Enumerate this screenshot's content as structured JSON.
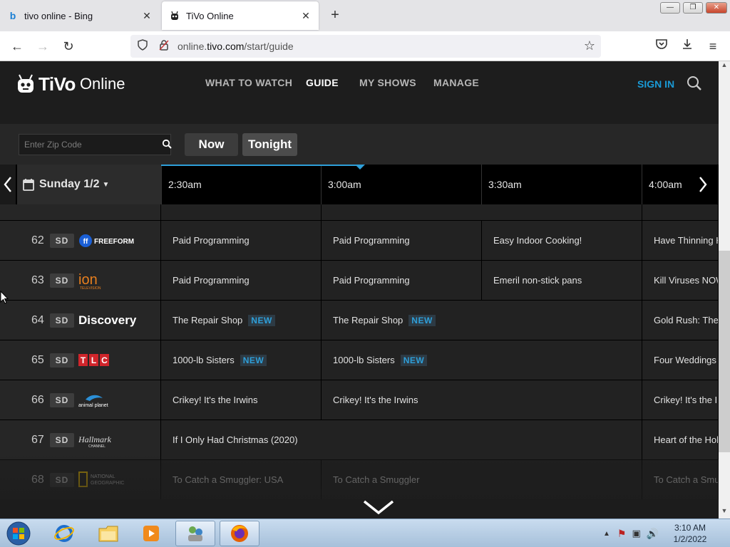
{
  "browser": {
    "tabs": [
      {
        "title": "tivo online - Bing",
        "favicon": "bing-icon",
        "active": false
      },
      {
        "title": "TiVo Online",
        "favicon": "tivo-icon",
        "active": true
      }
    ],
    "url_domain_prefix": "online.",
    "url_domain": "tivo.com",
    "url_path": "/start/guide"
  },
  "site": {
    "brand": "TiVo",
    "brand_suffix": "Online",
    "nav": [
      "WHAT TO WATCH",
      "GUIDE",
      "MY SHOWS",
      "MANAGE"
    ],
    "active_nav": "GUIDE",
    "sign_in": "SIGN IN",
    "accent": "#2e9fd9"
  },
  "controls": {
    "zip_placeholder": "Enter Zip Code",
    "now_label": "Now",
    "tonight_label": "Tonight"
  },
  "guide": {
    "date": "Sunday 1/2",
    "time_slots": [
      "2:30am",
      "3:00am",
      "3:30am",
      "4:00am"
    ],
    "channels": [
      {
        "number": "62",
        "quality": "SD",
        "logo": "freeform-logo",
        "logo_text": "FREEFORM",
        "programs": [
          {
            "title": "Paid Programming",
            "new": false
          },
          {
            "title": "Paid Programming",
            "new": false
          },
          {
            "title": "Easy Indoor Cooking!",
            "new": false
          },
          {
            "title": "Have Thinning Hair?",
            "new": false
          }
        ]
      },
      {
        "number": "63",
        "quality": "SD",
        "logo": "ion-logo",
        "logo_text": "ion",
        "programs": [
          {
            "title": "Paid Programming",
            "new": false
          },
          {
            "title": "Paid Programming",
            "new": false
          },
          {
            "title": "Emeril non-stick pans",
            "new": false
          },
          {
            "title": "Kill Viruses NOW!",
            "new": false
          }
        ]
      },
      {
        "number": "64",
        "quality": "SD",
        "logo": "discovery-logo",
        "logo_text": "Discovery",
        "programs": [
          {
            "title": "The Repair Shop",
            "new": true
          },
          {
            "title": "The Repair Shop",
            "new": true
          },
          {
            "title": "Gold Rush: The Dirt",
            "new": false
          }
        ]
      },
      {
        "number": "65",
        "quality": "SD",
        "logo": "tlc-logo",
        "logo_text": "TLC",
        "programs": [
          {
            "title": "1000-lb Sisters",
            "new": true
          },
          {
            "title": "1000-lb Sisters",
            "new": true
          },
          {
            "title": "Four Weddings",
            "new": false
          }
        ]
      },
      {
        "number": "66",
        "quality": "SD",
        "logo": "animal-planet-logo",
        "logo_text": "animal planet",
        "programs": [
          {
            "title": "Crikey! It's the Irwins",
            "new": false
          },
          {
            "title": "Crikey! It's the Irwins",
            "new": false
          },
          {
            "title": "Crikey! It's the Irwins",
            "new": false
          }
        ]
      },
      {
        "number": "67",
        "quality": "SD",
        "logo": "hallmark-logo",
        "logo_text": "Hallmark",
        "programs": [
          {
            "title": "If I Only Had Christmas (2020)",
            "new": false
          },
          {
            "title": "Heart of the Holidays",
            "new": false
          }
        ]
      },
      {
        "number": "68",
        "quality": "SD",
        "logo": "national-geographic-logo",
        "logo_text": "NATIONAL GEOGRAPHIC",
        "programs": [
          {
            "title": "To Catch a Smuggler: USA",
            "new": false
          },
          {
            "title": "To Catch a Smuggler",
            "new": false
          },
          {
            "title": "To Catch a Smuggler",
            "new": false
          }
        ]
      }
    ],
    "new_label": "NEW"
  },
  "taskbar": {
    "time": "3:10 AM",
    "date": "1/2/2022"
  }
}
